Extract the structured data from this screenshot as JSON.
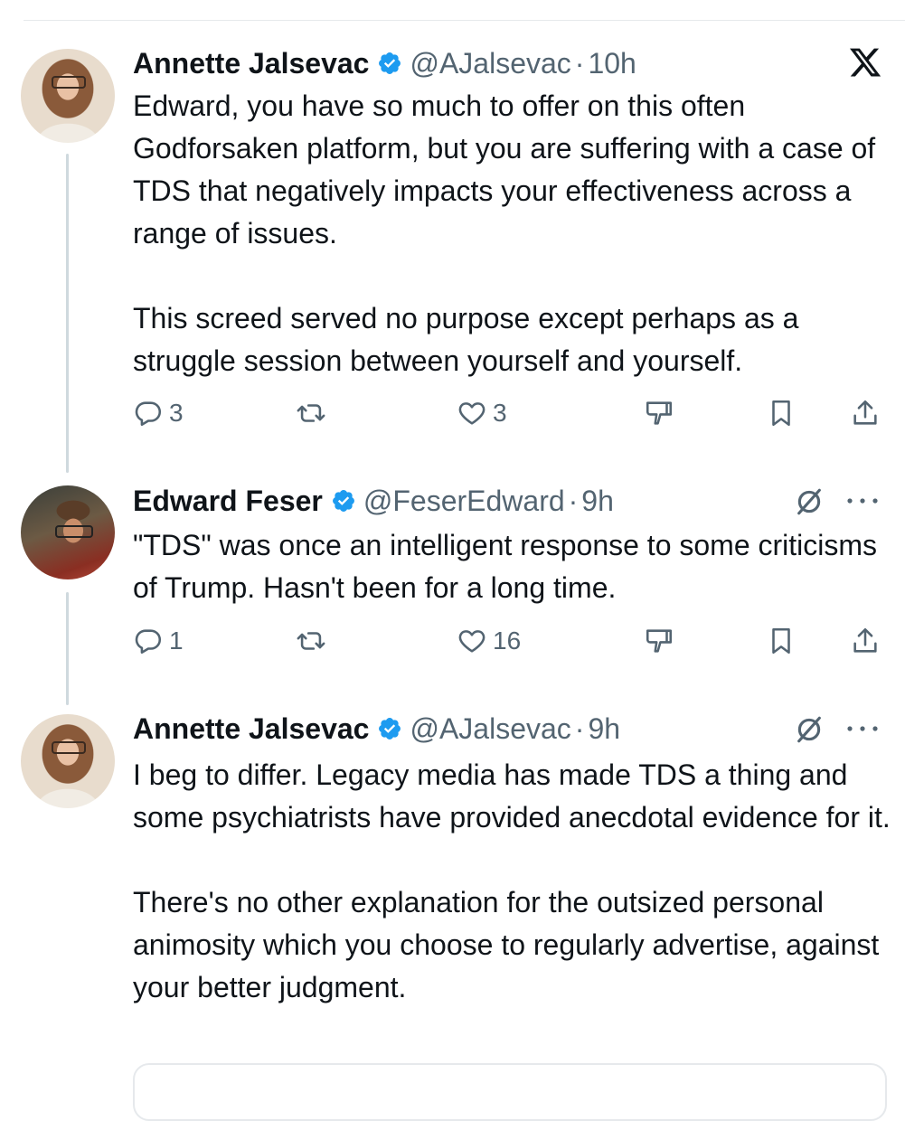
{
  "colors": {
    "text": "#0f1419",
    "secondary": "#536471",
    "verified": "#1d9bf0",
    "thread_line": "#cfd9de"
  },
  "tweets": [
    {
      "name": "Annette Jalsevac",
      "handle": "@AJalsevac",
      "time": "10h",
      "corner_icon": "x-logo-icon",
      "paragraphs": [
        "Edward, you have so much to offer on this often Godforsaken platform, but you are suffering with a case of TDS that negatively impacts your effectiveness across a range of issues.",
        "This screed served no purpose except perhaps as a struggle session between yourself and yourself."
      ],
      "replies": "3",
      "retweets": "",
      "likes": "3"
    },
    {
      "name": "Edward Feser",
      "handle": "@FeserEdward",
      "time": "9h",
      "corner_icon": "grok-icon",
      "paragraphs": [
        "\"TDS\" was once an intelligent response to some criticisms of Trump. Hasn't been for a long time."
      ],
      "replies": "1",
      "retweets": "",
      "likes": "16"
    },
    {
      "name": "Annette Jalsevac",
      "handle": "@AJalsevac",
      "time": "9h",
      "corner_icon": "grok-icon",
      "paragraphs": [
        "I beg to differ. Legacy media has made TDS a thing and some psychiatrists have provided anecdotal evidence for it.",
        "There's no other explanation for the outsized personal animosity which you choose to regularly advertise, against your better judgment."
      ]
    }
  ],
  "separator": "·"
}
